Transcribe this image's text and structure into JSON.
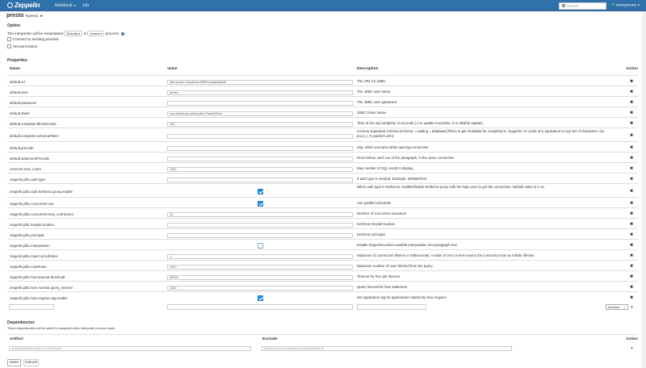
{
  "nav": {
    "brand": "Zeppelin",
    "notebook": "Notebook",
    "job": "Job",
    "search_placeholder": "Search",
    "user": "anonymous"
  },
  "interpreter": {
    "name": "presto",
    "tag": "%presto"
  },
  "option": {
    "label": "Option",
    "instantiated_prefix": "The interpreter will be instantiated",
    "mode": "Globally",
    "in_label": "in",
    "scope": "shared",
    "process_label": "process",
    "connect_existing": "Connect to existing process",
    "set_permission": "Set permission"
  },
  "properties": {
    "label": "Properties",
    "headers": {
      "name": "Name",
      "value": "Value",
      "description": "Description",
      "action": "Action"
    },
    "rows": [
      {
        "name": "default.url",
        "value": "jdbc:presto://localhost:8080/mysql/default",
        "desc": "The URL for JDBC."
      },
      {
        "name": "default.user",
        "value": "presto",
        "desc": "The JDBC user name"
      },
      {
        "name": "default.password",
        "value": "",
        "desc": "The JDBC user password"
      },
      {
        "name": "default.driver",
        "value": "com.facebook.presto.jdbc.PrestoDriver",
        "desc": "JDBC Driver Name"
      },
      {
        "name": "default.completer.ttlInSeconds",
        "value": "120",
        "desc": "Time to live sql completer in seconds (-1 to update everytime, 0 to disable update)"
      },
      {
        "name": "default.completer.schemaFilters",
        "value": "",
        "desc": "Comma separated schema (schema = catalog = database) filters to get metadata for completions. Supports '%' symb ol is equivalent to any set of characters. (ex. prod_v_%,public%,info)"
      },
      {
        "name": "default.precode",
        "value": "",
        "desc": "SQL which executes while opening connection"
      },
      {
        "name": "default.statementPrecode",
        "value": "",
        "desc": "Runs before each run of the paragraph, in the same connection"
      },
      {
        "name": "common.max_count",
        "value": "1000",
        "desc": "Max number of SQL result to display."
      },
      {
        "name": "zeppelin.jdbc.auth.type",
        "value": "",
        "desc": "If auth type is needed, Example: KERBEROS"
      },
      {
        "name": "zeppelin.jdbc.auth.kerberos.proxy.enable",
        "value": "",
        "check": true,
        "desc": "When auth type is Kerberos, enable/disable Kerberos proxy with the login user to get the connection. Default value is tr ue."
      },
      {
        "name": "zeppelin.jdbc.concurrent.use",
        "value": "",
        "check": true,
        "desc": "Use parallel scheduler"
      },
      {
        "name": "zeppelin.jdbc.concurrent.max_connection",
        "value": "10",
        "desc": "Number of concurrent execution"
      },
      {
        "name": "zeppelin.jdbc.keytab.location",
        "value": "",
        "desc": "Kerberos keytab location"
      },
      {
        "name": "zeppelin.jdbc.principal",
        "value": "",
        "desc": "Kerberos principal"
      },
      {
        "name": "zeppelin.jdbc.interpolation",
        "value": "",
        "check": false,
        "desc": "Enable ZeppelinContext variable interpolation into paragraph text"
      },
      {
        "name": "zeppelin.jdbc.maxConnLifetime",
        "value": "-1",
        "desc": "Maximum of connection lifetime in milliseconds. A value of zero or less means the connection has an infinite lifetime."
      },
      {
        "name": "zeppelin.jdbc.maxRows",
        "value": "1000",
        "desc": "Maximum number of rows fetched from the query."
      },
      {
        "name": "zeppelin.jdbc.hive.timeout.threshold",
        "value": "60000",
        "desc": "Timeout for hive job timeout"
      },
      {
        "name": "zeppelin.jdbc.hive.monitor.query_interval",
        "value": "1000",
        "desc": "Query interval for hive statement"
      },
      {
        "name": "zeppelin.jdbc.hive.engines.tag.enable",
        "value": "",
        "check": true,
        "desc": "Set application tag for applications started by hive engines"
      }
    ],
    "new_type": "textarea"
  },
  "dependencies": {
    "label": "Dependencies",
    "note": "These dependencies will be added to classpath when interpreter process starts.",
    "headers": {
      "artifact": "Artifact",
      "exclude": "Exclude",
      "action": "Action"
    },
    "artifact_placeholder": "groupId:artifactId:version or local file path",
    "exclude_placeholder": "(Optional) comma separated groupId:artifactId list"
  },
  "buttons": {
    "save": "Save",
    "cancel": "Cancel"
  }
}
